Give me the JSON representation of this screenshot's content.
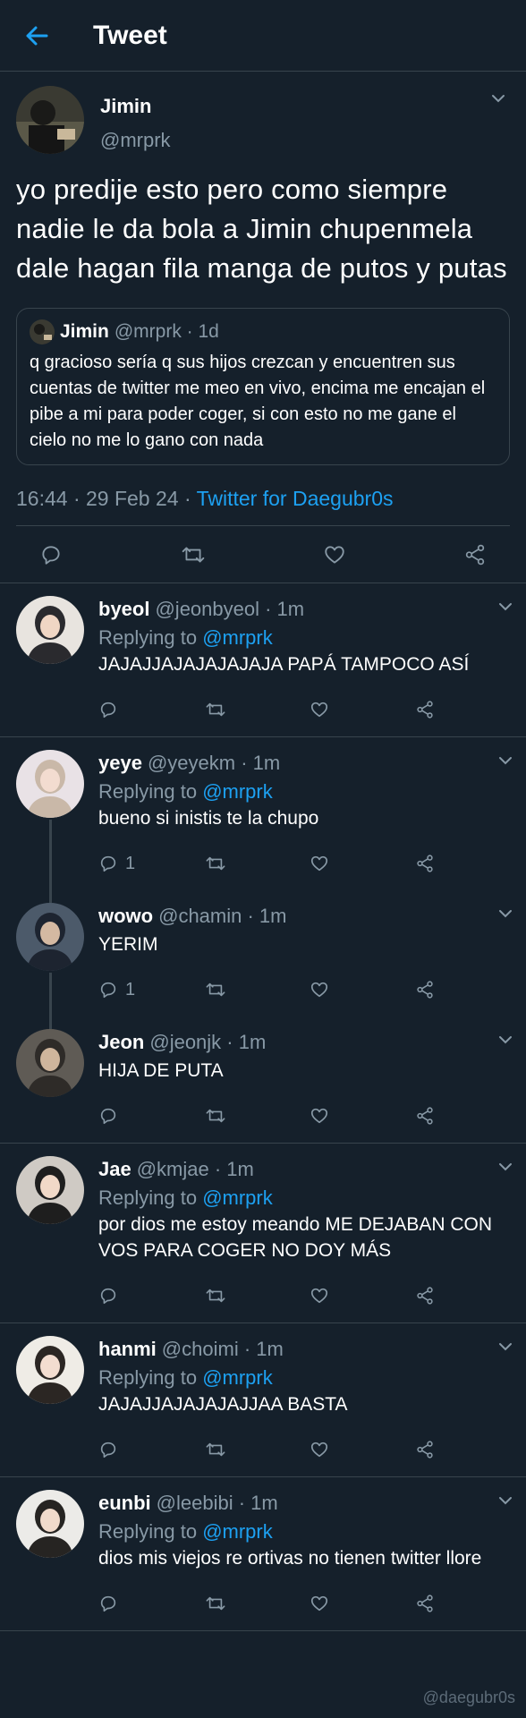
{
  "header": {
    "title": "Tweet"
  },
  "main_tweet": {
    "name": "Jimin",
    "handle": "@mrprk",
    "text": "yo predije esto pero como siempre nadie le da bola a Jimin chupenmela dale hagan fila manga de putos y putas",
    "quote": {
      "name": "Jimin",
      "handle_time": "@mrprk · 1d",
      "text": "q gracioso sería q sus hijos crezcan y encuentren sus cuentas de twitter me meo en vivo, encima me encajan el pibe a mi para poder coger, si con esto no me gane el cielo no me lo gano con nada"
    },
    "timestamp": "16:44 · 29 Feb 24 · ",
    "source": "Twitter for Daegubr0s"
  },
  "replies": [
    {
      "name": "byeol",
      "handle_time": "@jeonbyeol · 1m",
      "replying_prefix": "Replying to ",
      "replying_to": "@mrprk",
      "text": "JAJAJJAJAJAJAJAJA PAPÁ TAMPOCO ASÍ",
      "reply_count": ""
    },
    {
      "name": "yeye",
      "handle_time": "@yeyekm · 1m",
      "replying_prefix": "Replying to ",
      "replying_to": "@mrprk",
      "text": "bueno si inistis te la chupo",
      "reply_count": "1"
    },
    {
      "name": "wowo",
      "handle_time": "@chamin · 1m",
      "text": "YERIM",
      "reply_count": "1"
    },
    {
      "name": "Jeon",
      "handle_time": "@jeonjk · 1m",
      "text": "HIJA DE PUTA",
      "reply_count": ""
    },
    {
      "name": "Jae",
      "handle_time": "@kmjae · 1m",
      "replying_prefix": "Replying to ",
      "replying_to": "@mrprk",
      "text": "por dios me estoy meando ME DEJABAN CON VOS PARA COGER NO DOY MÁS",
      "reply_count": ""
    },
    {
      "name": "hanmi",
      "handle_time": "@choimi · 1m",
      "replying_prefix": "Replying to ",
      "replying_to": "@mrprk",
      "text": "JAJAJJAJAJAJAJJAA BASTA",
      "reply_count": ""
    },
    {
      "name": "eunbi",
      "handle_time": "@leebibi · 1m",
      "replying_prefix": "Replying to ",
      "replying_to": "@mrprk",
      "text": "dios mis viejos re ortivas no tienen twitter llore",
      "reply_count": ""
    }
  ],
  "watermark": "@daegubr0s",
  "colors": {
    "background": "#15202b",
    "accent": "#1da1f2",
    "muted": "#8899a6",
    "divider": "#38444d"
  },
  "icons": [
    "back-arrow-icon",
    "chevron-down-icon",
    "reply-icon",
    "retweet-icon",
    "like-icon",
    "share-icon"
  ]
}
